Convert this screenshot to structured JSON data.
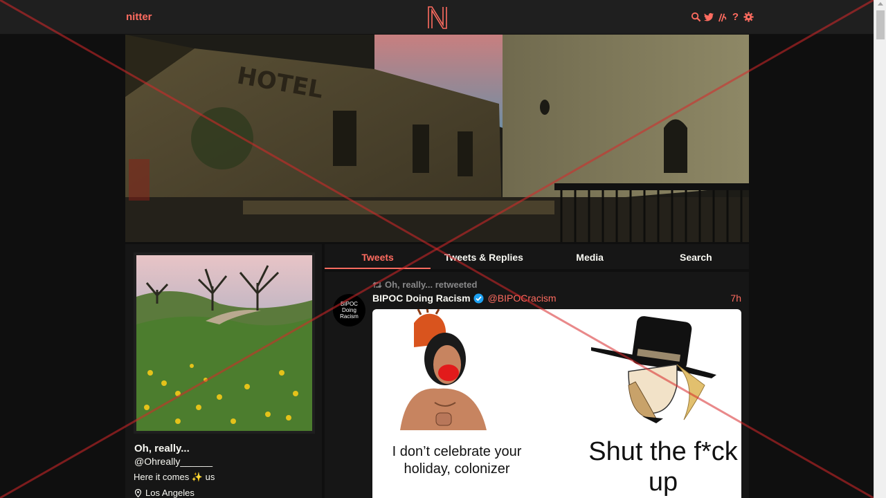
{
  "navbar": {
    "brand": "nitter",
    "logo_letter": "N",
    "icons": [
      "search-icon",
      "bird-icon",
      "rss-icon",
      "help-icon",
      "gear-icon"
    ],
    "help_glyph": "?",
    "rss_glyph": "ʘ"
  },
  "profile": {
    "fullname": "Oh, really...",
    "username": "@Ohreally______",
    "bio": "Here it comes ✨ us",
    "location": "Los Angeles"
  },
  "tabs": [
    {
      "label": "Tweets",
      "active": true
    },
    {
      "label": "Tweets & Replies",
      "active": false
    },
    {
      "label": "Media",
      "active": false
    },
    {
      "label": "Search",
      "active": false
    }
  ],
  "tweet": {
    "retweet_header": "Oh, really... retweeted",
    "avatar_text": "BIPOC Doing Racism",
    "fullname": "BIPOC Doing Racism",
    "username": "@BIPOCracism",
    "date": "7h",
    "media": {
      "left_caption": "I don’t celebrate your holiday, colonizer",
      "right_caption": "Shut the f*ck up"
    }
  },
  "colors": {
    "accent": "#ff6c60",
    "background": "#0f0f0f",
    "panel": "#161616",
    "nav": "#1f1f1f",
    "verified": "#1da1f2"
  }
}
